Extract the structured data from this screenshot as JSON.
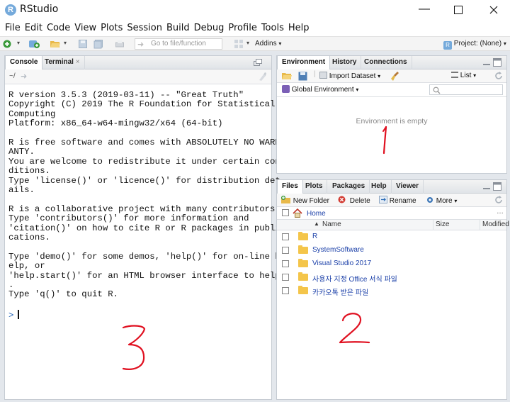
{
  "window": {
    "title": "RStudio",
    "app_icon_letter": "R"
  },
  "menu": [
    "File",
    "Edit",
    "Code",
    "View",
    "Plots",
    "Session",
    "Build",
    "Debug",
    "Profile",
    "Tools",
    "Help"
  ],
  "toolbar": {
    "goto_placeholder": "Go to file/function",
    "addins_label": "Addins",
    "project_label": "Project: (None)"
  },
  "console_pane": {
    "tabs": [
      "Console",
      "Terminal"
    ],
    "path": "~/",
    "lines": [
      "R version 3.5.3 (2019-03-11) -- \"Great Truth\"",
      "Copyright (C) 2019 The R Foundation for Statistical",
      "Computing",
      "Platform: x86_64-w64-mingw32/x64 (64-bit)",
      "",
      "R is free software and comes with ABSOLUTELY NO WARR",
      "ANTY.",
      "You are welcome to redistribute it under certain con",
      "ditions.",
      "Type 'license()' or 'licence()' for distribution det",
      "ails.",
      "",
      "R is a collaborative project with many contributors.",
      "Type 'contributors()' for more information and",
      "'citation()' on how to cite R or R packages in publi",
      "cations.",
      "",
      "Type 'demo()' for some demos, 'help()' for on-line h",
      "elp, or",
      "'help.start()' for an HTML browser interface to help",
      ".",
      "Type 'q()' to quit R."
    ],
    "prompt": ">"
  },
  "environment_pane": {
    "tabs": [
      "Environment",
      "History",
      "Connections"
    ],
    "import_label": "Import Dataset",
    "list_label": "List",
    "scope_label": "Global Environment",
    "empty_message": "Environment is empty"
  },
  "files_pane": {
    "tabs": [
      "Files",
      "Plots",
      "Packages",
      "Help",
      "Viewer"
    ],
    "actions": [
      "New Folder",
      "Delete",
      "Rename",
      "More"
    ],
    "breadcrumb": "Home",
    "columns": [
      "Name",
      "Size",
      "Modified"
    ],
    "files": [
      "R",
      "SystemSoftware",
      "Visual Studio 2017",
      "사용자 지정 Office 서식 파일",
      "카카오톡 받은 파일"
    ]
  },
  "annotations": [
    "1",
    "2",
    "3"
  ],
  "colors": {
    "accent_blue": "#1a3fa8",
    "annotation_red": "#e01020",
    "pane_border": "#c5cbd2"
  }
}
